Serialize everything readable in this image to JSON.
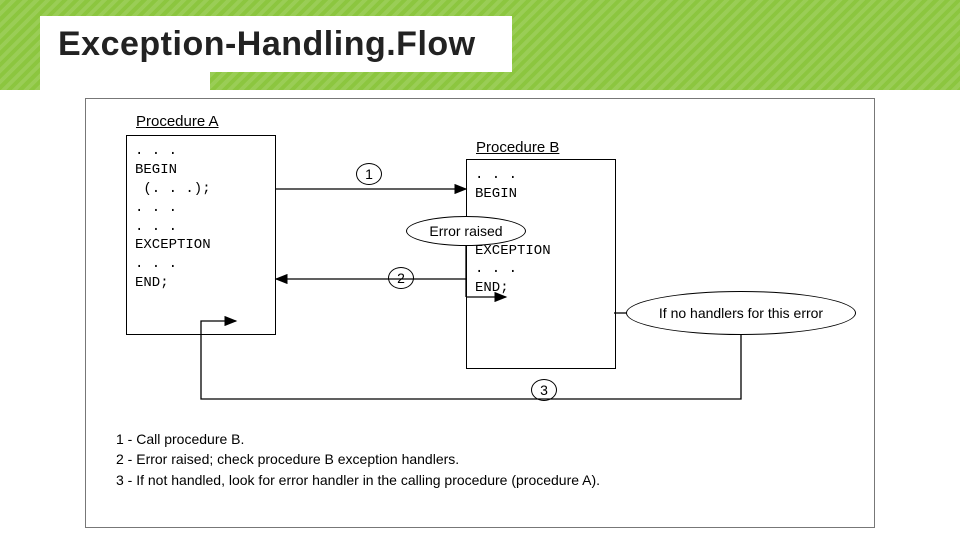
{
  "header": {
    "title": "Exception-Handling.Flow"
  },
  "diagram": {
    "procA": {
      "label": "Procedure A",
      "code": ". . .\nBEGIN\n (. . .);\n. . .\n. . .\nEXCEPTION\n. . .\nEND;"
    },
    "procB": {
      "label": "Procedure B",
      "code": ". . .\nBEGIN\n\n. . .\nEXCEPTION\n. . .\nEND;"
    },
    "steps": {
      "s1": "1",
      "s2": "2",
      "s3": "3"
    },
    "bubbles": {
      "error_raised": "Error raised",
      "no_handlers": "If no handlers for this error"
    },
    "legend": {
      "l1": "1 - Call procedure B.",
      "l2": "2 - Error raised; check procedure B exception handlers.",
      "l3": "3 - If not handled, look for error handler in the calling procedure (procedure A)."
    }
  }
}
